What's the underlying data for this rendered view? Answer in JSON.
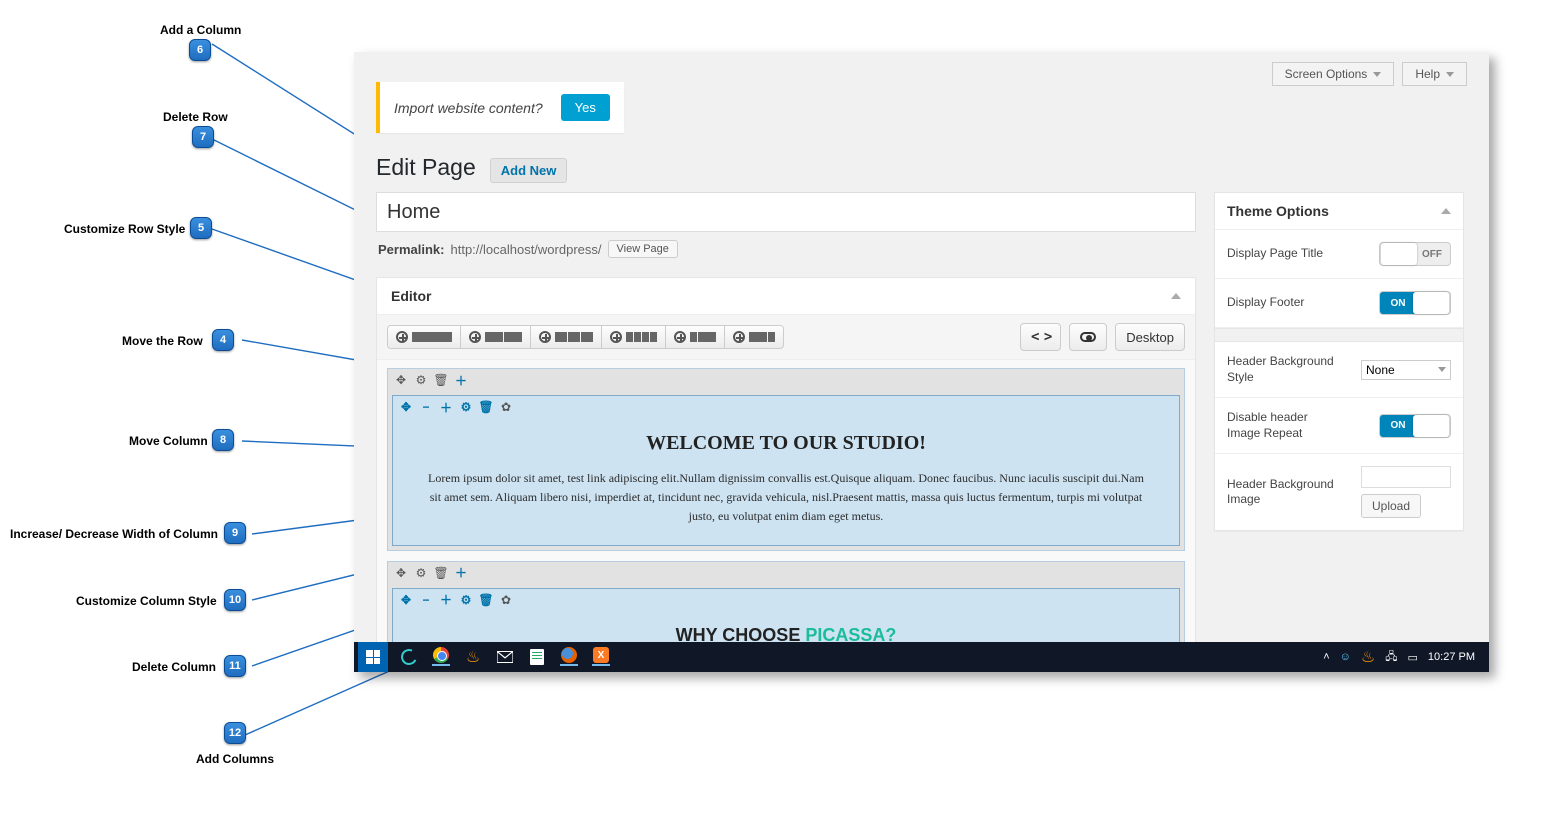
{
  "callouts": {
    "1": "Add a Row",
    "2": "Edit Source Code",
    "3": "Preview",
    "4": "Move the Row",
    "5": "Customize Row Style",
    "6": "Add a Column",
    "7": "Delete Row",
    "8": "Move Column",
    "9": "Increase/ Decrease Width of Column",
    "10": "Customize Column Style",
    "11": "Delete Column",
    "12": "Add Columns"
  },
  "top": {
    "screen_options": "Screen Options",
    "help": "Help"
  },
  "notice": {
    "text": "Import website content?",
    "button": "Yes"
  },
  "heading": {
    "title": "Edit Page",
    "addnew": "Add New"
  },
  "post": {
    "title_value": "Home",
    "permalink_label": "Permalink:",
    "permalink_url": "http://localhost/wordpress/",
    "view_page": "View Page"
  },
  "editor": {
    "label": "Editor",
    "desktop": "Desktop",
    "row1": {
      "heading": "WELCOME TO OUR STUDIO!",
      "body": "Lorem ipsum dolor sit amet, test link adipiscing elit.Nullam dignissim convallis est.Quisque aliquam. Donec faucibus. Nunc iaculis suscipit dui.Nam sit amet sem. Aliquam libero nisi, imperdiet at, tincidunt nec, gravida vehicula, nisl.Praesent mattis, massa quis luctus fermentum, turpis mi volutpat justo, eu volutpat enim diam eget metus."
    },
    "row2": {
      "heading_a": "WHY CHOOSE ",
      "heading_b": "PICASSA?"
    }
  },
  "theme": {
    "title": "Theme Options",
    "display_page_title": "Display Page Title",
    "display_footer": "Display Footer",
    "header_bg_style": "Header Background Style",
    "header_bg_style_val": "None",
    "disable_header_repeat": "Disable header Image Repeat",
    "header_bg_image": "Header Background Image",
    "upload": "Upload",
    "on": "ON",
    "off": "OFF"
  },
  "taskbar": {
    "time": "10:27 PM"
  }
}
